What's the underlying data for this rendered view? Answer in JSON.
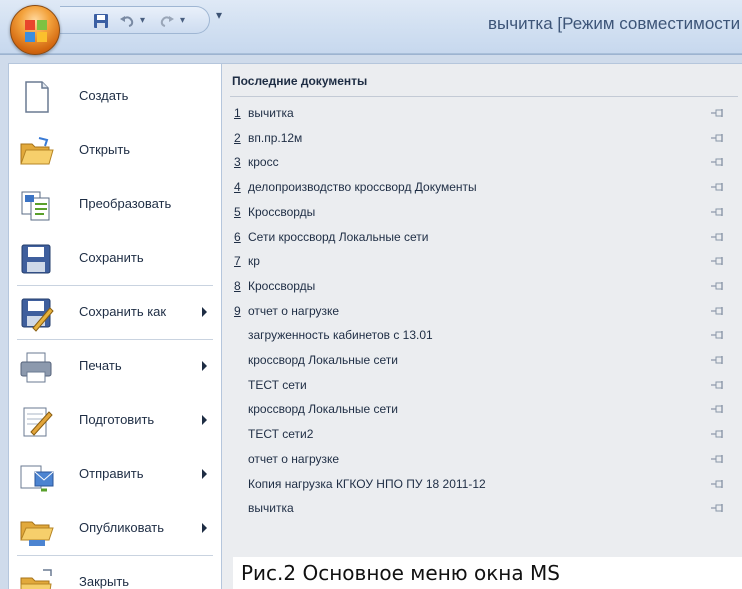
{
  "window": {
    "title": "вычитка  [Режим совместимости"
  },
  "quick_access": {
    "more_glyph": "▾"
  },
  "menu": {
    "items": [
      {
        "label": "Создать",
        "icon": "new-document-icon",
        "arrow": false
      },
      {
        "label": "Открыть",
        "icon": "open-folder-icon",
        "arrow": false
      },
      {
        "label": "Преобразовать",
        "icon": "convert-icon",
        "arrow": false
      },
      {
        "label": "Сохранить",
        "icon": "save-icon",
        "arrow": false
      },
      {
        "label": "Сохранить как",
        "icon": "save-as-icon",
        "arrow": true
      },
      {
        "label": "Печать",
        "icon": "print-icon",
        "arrow": true
      },
      {
        "label": "Подготовить",
        "icon": "prepare-icon",
        "arrow": true
      },
      {
        "label": "Отправить",
        "icon": "send-icon",
        "arrow": true
      },
      {
        "label": "Опубликовать",
        "icon": "publish-icon",
        "arrow": true
      },
      {
        "label": "Закрыть",
        "icon": "close-folder-icon",
        "arrow": false
      }
    ]
  },
  "recent": {
    "header": "Последние документы",
    "items": [
      {
        "num": "1",
        "name": "вычитка"
      },
      {
        "num": "2",
        "name": "вп.пр.12м"
      },
      {
        "num": "3",
        "name": "кросс"
      },
      {
        "num": "4",
        "name": "делопроизводство кроссворд Документы"
      },
      {
        "num": "5",
        "name": "Кроссворды"
      },
      {
        "num": "6",
        "name": "Сети кроссворд Локальные сети"
      },
      {
        "num": "7",
        "name": "кр"
      },
      {
        "num": "8",
        "name": "Кроссворды"
      },
      {
        "num": "9",
        "name": "отчет о нагрузке"
      },
      {
        "num": "",
        "name": "загруженность кабинетов  с 13.01"
      },
      {
        "num": "",
        "name": "кроссворд Локальные сети"
      },
      {
        "num": "",
        "name": "ТЕСТ сети"
      },
      {
        "num": "",
        "name": "кроссворд Локальные сети"
      },
      {
        "num": "",
        "name": "ТЕСТ сети2"
      },
      {
        "num": "",
        "name": "отчет о нагрузке"
      },
      {
        "num": "",
        "name": "Копия нагрузка КГКОУ НПО ПУ 18 2011-12"
      },
      {
        "num": "",
        "name": "вычитка"
      }
    ]
  },
  "caption": "Рис.2 Основное меню окна MS"
}
